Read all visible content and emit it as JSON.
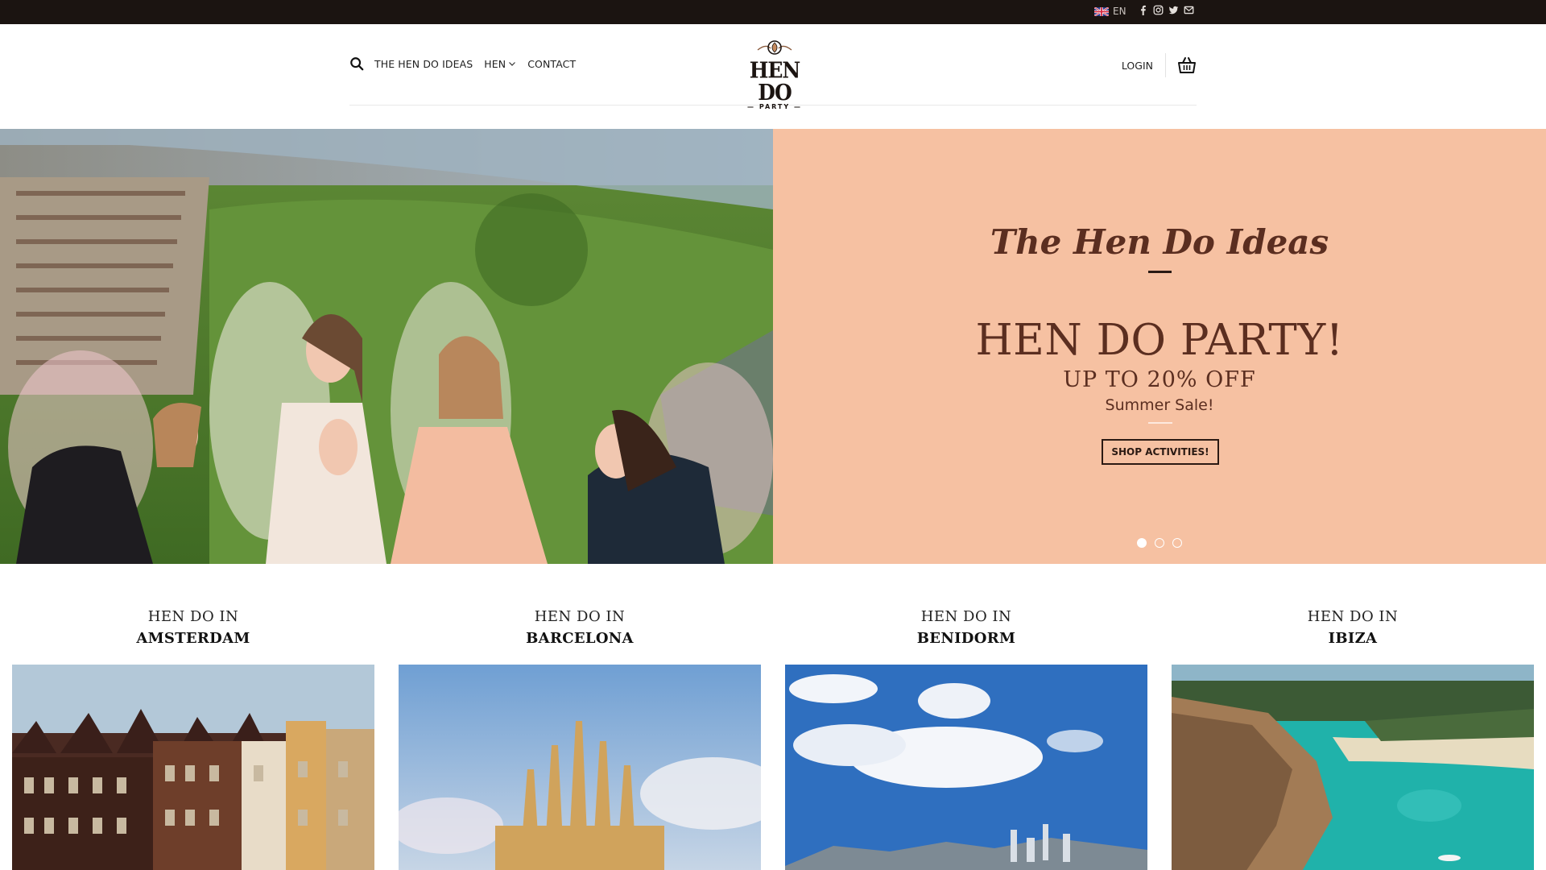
{
  "topbar": {
    "language": "EN",
    "social_icons": [
      "facebook-icon",
      "instagram-icon",
      "twitter-icon",
      "email-icon"
    ]
  },
  "header": {
    "nav": {
      "ideas": "THE HEN DO IDEAS",
      "hen": "HEN",
      "contact": "CONTACT"
    },
    "logo": {
      "main": "HEN DO",
      "sub": "PARTY"
    },
    "login": "LOGIN"
  },
  "hero": {
    "kicker": "The Hen Do Ideas",
    "title": "HEN DO PARTY!",
    "subtitle": "UP TO 20% OFF",
    "tagline": "Summer Sale!",
    "button": "SHOP ACTIVITIES!",
    "slide_count": 3,
    "active_slide": 1,
    "background": "#f6c1a2",
    "text_color": "#5b2e20"
  },
  "destinations": [
    {
      "line1": "HEN DO IN",
      "city": "AMSTERDAM"
    },
    {
      "line1": "HEN DO IN",
      "city": "BARCELONA"
    },
    {
      "line1": "HEN DO IN",
      "city": "BENIDORM"
    },
    {
      "line1": "HEN DO IN",
      "city": "IBIZA"
    }
  ]
}
